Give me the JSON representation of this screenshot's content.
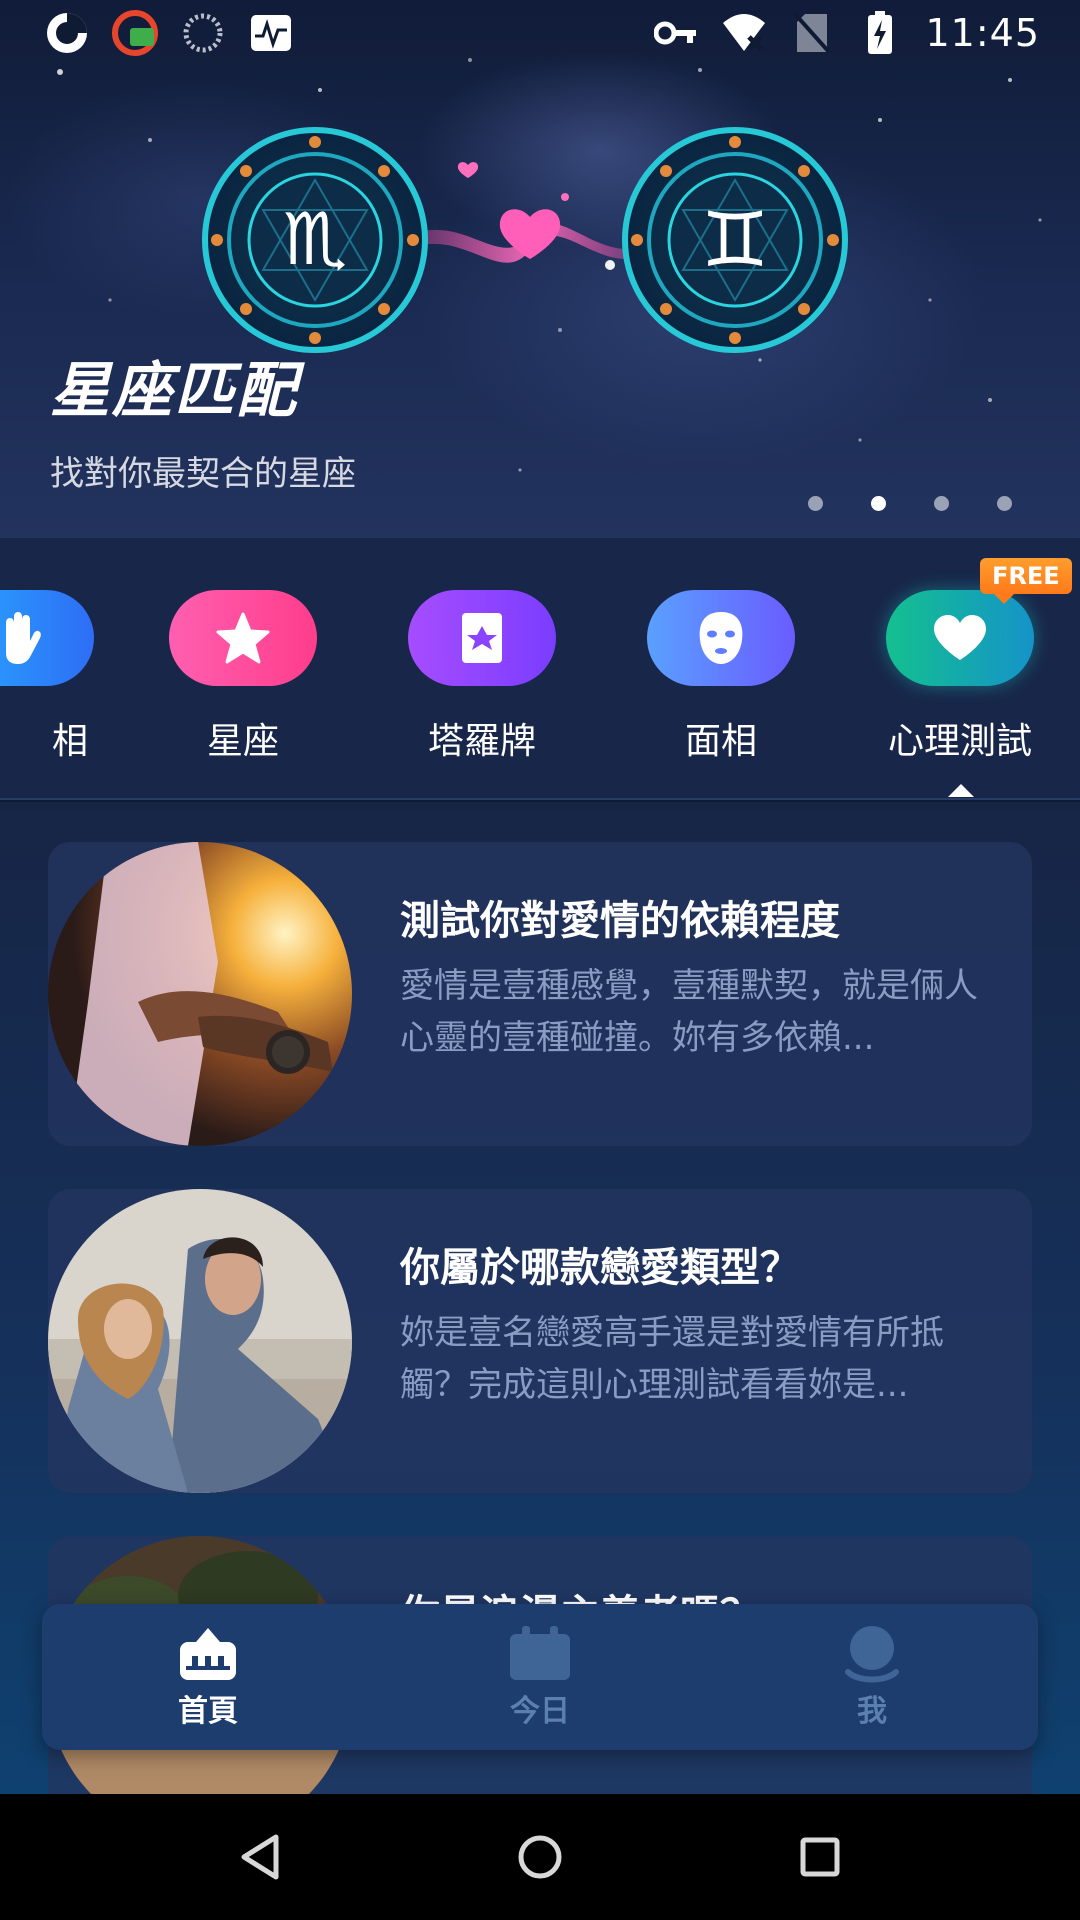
{
  "status_bar": {
    "time": "11:45",
    "left_icons": [
      "app-refresh-icon",
      "app-badge-icon",
      "loading-icon",
      "activity-monitor-icon"
    ],
    "right_icons": [
      "vpn-key-icon",
      "wifi-off-icon",
      "no-sim-icon",
      "battery-charging-icon"
    ]
  },
  "banner": {
    "title": "星座匹配",
    "subtitle": "找對你最契合的星座",
    "page_count": 4,
    "active_page": 2
  },
  "categories": [
    {
      "label": "相",
      "icon": "palm-icon",
      "gradient": [
        "#29a8ff",
        "#2d6ef5"
      ]
    },
    {
      "label": "星座",
      "icon": "star-icon",
      "gradient": [
        "#ff5fb1",
        "#ff3d8b"
      ]
    },
    {
      "label": "塔羅牌",
      "icon": "tarot-card-icon",
      "gradient": [
        "#a64dff",
        "#7a3dff"
      ]
    },
    {
      "label": "面相",
      "icon": "face-mask-icon",
      "gradient": [
        "#5aa0ff",
        "#6a5cff"
      ]
    },
    {
      "label": "心理測試",
      "icon": "heart-icon",
      "gradient": [
        "#14c08f",
        "#1593c9"
      ],
      "badge": "FREE",
      "selected": true
    }
  ],
  "cards": [
    {
      "title": "測試你對愛情的依賴程度",
      "description": "愛情是壹種感覺，壹種默契，就是倆人心靈的壹種碰撞。妳有多依賴...",
      "image": "couple-holding-hands"
    },
    {
      "title": "你屬於哪款戀愛類型？",
      "description": "妳是壹名戀愛高手還是對愛情有所抵觸？完成這則心理測試看看妳是...",
      "image": "couple-denim"
    },
    {
      "title": "你是浪漫主義者嗎？",
      "description": "",
      "image": "leaves"
    }
  ],
  "bottom_nav": {
    "items": [
      {
        "label": "首頁",
        "icon": "home-icon",
        "active": true
      },
      {
        "label": "今日",
        "icon": "calendar-icon",
        "active": false
      },
      {
        "label": "我",
        "icon": "profile-icon",
        "active": false
      }
    ]
  },
  "colors": {
    "accent_free": "#ff8a24",
    "nav_bg": "#1c3d6e",
    "nav_inactive": "#5b7fae"
  }
}
